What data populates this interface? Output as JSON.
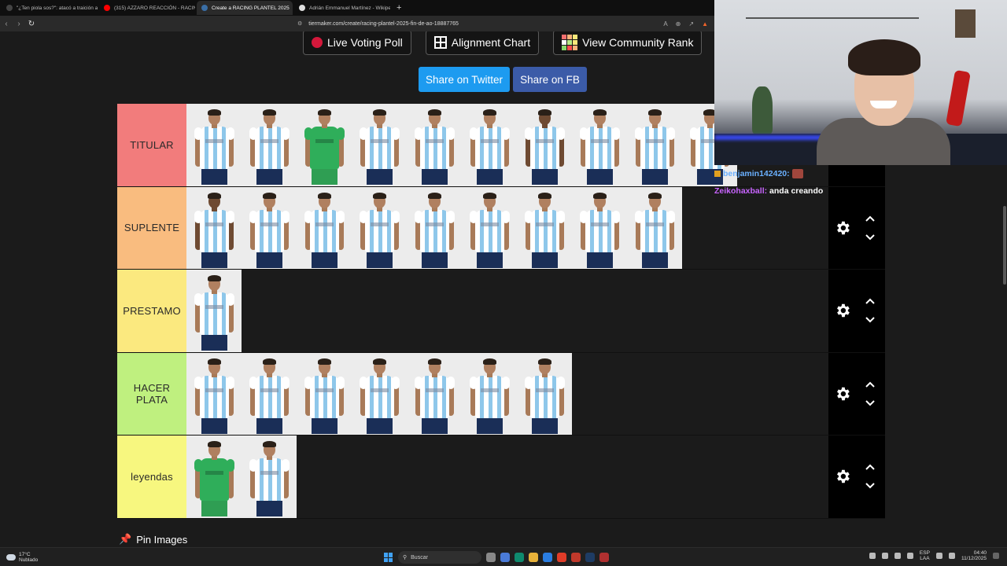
{
  "browser": {
    "tabs": [
      {
        "title": "\"¿Ten piola sos?\": atacó a traición a u",
        "active": false,
        "favicon_color": "#444444"
      },
      {
        "title": "(315) AZZARO REACCIÓN - RACING",
        "active": false,
        "favicon_color": "#ff0000"
      },
      {
        "title": "Create a RACING PLANTEL 2025",
        "active": true,
        "favicon_color": "#3a6ea5"
      },
      {
        "title": "Adrián Emmanuel Martínez - Wikipe",
        "active": false,
        "favicon_color": "#dddddd"
      }
    ],
    "url": "tiermaker.com/create/racing-plantel-2025-fin-de-ao-18887765"
  },
  "toolbar": {
    "live_voting_label": "Live Voting Poll",
    "alignment_label": "Alignment Chart",
    "community_rank_label": "View Community Rank",
    "share_twitter_label": "Share on Twitter",
    "share_fb_label": "Share on FB",
    "colors": {
      "live_dot": "#d4183b",
      "twitter": "#1d9bf0",
      "facebook": "#3b5ba8"
    },
    "rank_icon_colors": [
      "#f26f6f",
      "#f9b27a",
      "#f7e779",
      "#ffffff",
      "#b8e986",
      "#f7e779",
      "#8ad86b",
      "#ff4d4d",
      "#f9b27a"
    ]
  },
  "tiers": [
    {
      "label": "TITULAR",
      "color": "#f27c7c",
      "players": [
        "p",
        "p",
        "gk",
        "p",
        "p",
        "p",
        "dark",
        "p",
        "p",
        "p"
      ]
    },
    {
      "label": "SUPLENTE",
      "color": "#f9bc7f",
      "players": [
        "dark",
        "p",
        "p",
        "p",
        "p",
        "p",
        "p",
        "p",
        "p"
      ]
    },
    {
      "label": "PRESTAMO",
      "color": "#fbe97f",
      "players": [
        "p"
      ]
    },
    {
      "label": "HACER PLATA",
      "color": "#bff07f",
      "players": [
        "p",
        "p",
        "p",
        "p",
        "p",
        "p",
        "p"
      ]
    },
    {
      "label": "leyendas",
      "color": "#f7f77f",
      "players": [
        "gk",
        "p"
      ]
    }
  ],
  "pin": {
    "label": "Pin Images"
  },
  "chat": [
    {
      "user": "benjamin142420:",
      "message": "",
      "user_color": "#6ab0ff"
    },
    {
      "user": "Zeikohaxball:",
      "message": "anda creando",
      "user_color": "#c864ff"
    }
  ],
  "taskbar": {
    "temperature": "17°C",
    "weather": "Nublado",
    "search_placeholder": "Buscar",
    "lang_line1": "ESP",
    "lang_line2": "LAA",
    "time": "04:40",
    "date": "11/12/2025"
  }
}
